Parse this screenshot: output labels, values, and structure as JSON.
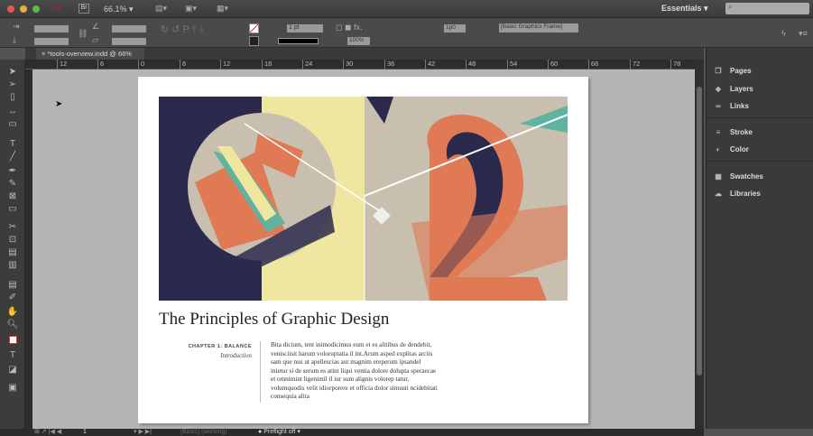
{
  "titlebar": {
    "app_logo": "Id",
    "bridge": "Br",
    "zoom": "66.1%",
    "workspace": "Essentials",
    "search_placeholder": ""
  },
  "control": {
    "stroke_weight": "1 pt",
    "opacity": "100%",
    "gap": "1p0",
    "object_style": "[Basic Graphics Frame]"
  },
  "document": {
    "tab_label": "*tools-overview.indd @ 66%",
    "close": "×"
  },
  "ruler": [
    "12",
    "6",
    "0",
    "6",
    "12",
    "18",
    "24",
    "30",
    "36",
    "42",
    "48",
    "54",
    "60",
    "66",
    "72",
    "78"
  ],
  "page": {
    "title": "The Principles of Graphic Design",
    "chapter": "CHAPTER 1: BALANCE",
    "section": "Introduction",
    "body": "Bita dicium, tent inimodicimus eum et es alitibus de dendebit, venisciisit harum voloruptatia il int.Arum asped explitas arciis sam que nus ut apellescias aut magnim ereperum ipsandel inietur si de serum es atint liqui ventia dolore dolupta speraecae et omnimint ligenimil il iur sum alignis volorep tatur, volumquodis velit idiorporere et officia dolor simusti ncidebitati consequia alita"
  },
  "panels": [
    {
      "label": "Pages",
      "icon": "pages-icon"
    },
    {
      "label": "Layers",
      "icon": "layers-icon"
    },
    {
      "label": "Links",
      "icon": "links-icon"
    },
    {
      "label": "Stroke",
      "icon": "stroke-icon"
    },
    {
      "label": "Color",
      "icon": "color-icon"
    },
    {
      "label": "Swatches",
      "icon": "swatches-icon"
    },
    {
      "label": "Libraries",
      "icon": "libraries-icon"
    }
  ],
  "status": {
    "page": "1",
    "style": "[Basic] (working)",
    "preflight": "Preflight off"
  },
  "colors": {
    "navy": "#2b2a4c",
    "yellow": "#efe6a0",
    "orange": "#e07a55",
    "teal": "#5fb3a0",
    "beige": "#c9bfae"
  }
}
